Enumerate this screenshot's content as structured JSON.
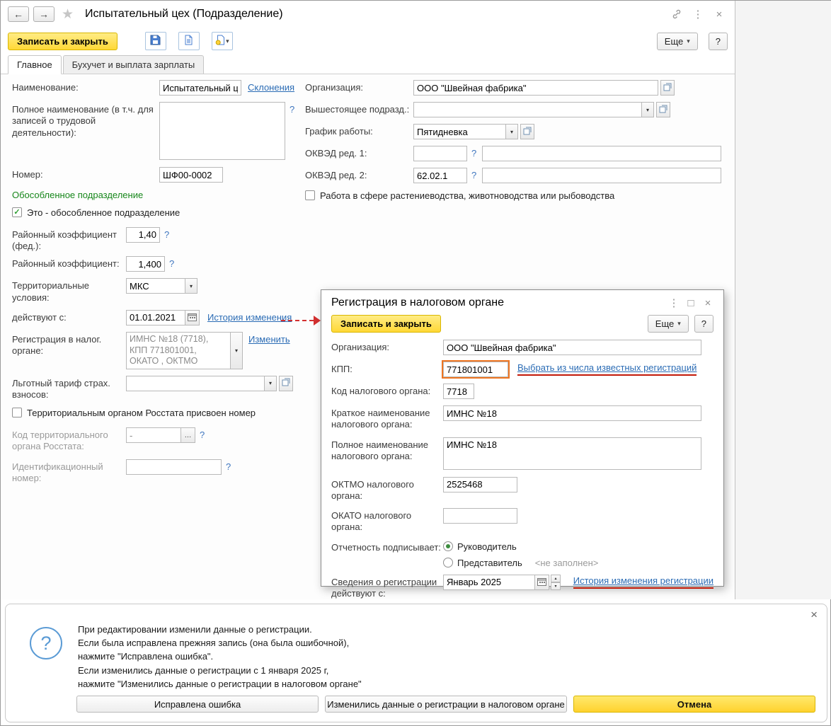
{
  "icons": {
    "back": "←",
    "forward": "→",
    "star": "★",
    "dots": "⋮",
    "close": "×",
    "maximize": "□",
    "caret": "▾",
    "check": "✓",
    "up": "▴",
    "down": "▾",
    "ellipsis": "…",
    "question_hint": "?",
    "question_big": "?"
  },
  "colors": {
    "accent_yellow": "#ffd836",
    "link_blue": "#2b6cb5",
    "annotation_red": "#d43030",
    "highlight_orange": "#ef7622",
    "section_green": "#17871b"
  },
  "window": {
    "title": "Испытательный цех (Подразделение)"
  },
  "toolbar": {
    "save_close": "Записать и закрыть",
    "more": "Еще",
    "help": "?"
  },
  "tabs": [
    {
      "label": "Главное"
    },
    {
      "label": "Бухучет и выплата зарплаты"
    }
  ],
  "form": {
    "name": {
      "label": "Наименование:",
      "value": "Испытательный це",
      "link": "Склонения"
    },
    "full_name": {
      "label": "Полное наименование (в т.ч. для записей о трудовой деятельности):",
      "value": ""
    },
    "number": {
      "label": "Номер:",
      "value": "ШФ00-0002"
    },
    "separate": {
      "heading": "Обособленное подразделение",
      "checkbox": "Это - обособленное подразделение"
    },
    "district_coef_fed": {
      "label": "Районный коэффициент (фед.):",
      "value": "1,40"
    },
    "district_coef": {
      "label": "Районный коэффициент:",
      "value": "1,400"
    },
    "territorial": {
      "label": "Территориальные условия:",
      "value": "МКС"
    },
    "valid_from": {
      "label": "действуют с:",
      "value": "01.01.2021",
      "link": "История изменения"
    },
    "tax_registration": {
      "label": "Регистрация в налог. органе:",
      "value": "ИМНС №18 (7718),\nКПП 771801001,\nОКАТО , ОКТМО",
      "link": "Изменить"
    },
    "privileged_tariff": {
      "label": "Льготный тариф страх. взносов:",
      "value": ""
    },
    "rosstat_checkbox": "Территориальным органом Росстата присвоен номер",
    "rosstat_code": {
      "label": "Код территориального органа Росстата:",
      "value": "-"
    },
    "id_number": {
      "label": "Идентификационный номер:",
      "value": ""
    },
    "organization": {
      "label": "Организация:",
      "value": "ООО \"Швейная фабрика\""
    },
    "parent_dept": {
      "label": "Вышестоящее подразд.:",
      "value": ""
    },
    "schedule": {
      "label": "График работы:",
      "value": "Пятидневка"
    },
    "okved1": {
      "label": "ОКВЭД ред. 1:",
      "code": "",
      "name": ""
    },
    "okved2": {
      "label": "ОКВЭД ред. 2:",
      "code": "62.02.1",
      "name": ""
    },
    "agro_checkbox": "Работа в сфере растениеводства, животноводства или рыбоводства"
  },
  "dialog": {
    "title": "Регистрация в налоговом органе",
    "save_close": "Записать и закрыть",
    "more": "Еще",
    "help": "?",
    "organization": {
      "label": "Организация:",
      "value": "ООО \"Швейная фабрика\""
    },
    "kpp": {
      "label": "КПП:",
      "value": "771801001",
      "link": "Выбрать из числа известных регистраций"
    },
    "tax_code": {
      "label": "Код налогового органа:",
      "value": "7718"
    },
    "short_name": {
      "label": "Краткое наименование налогового органа:",
      "value": "ИМНС №18"
    },
    "full_name": {
      "label": "Полное наименование налогового органа:",
      "value": "ИМНС №18"
    },
    "oktmo": {
      "label": "ОКТМО налогового органа:",
      "value": "2525468"
    },
    "okato": {
      "label": "ОКАТО налогового органа:",
      "value": ""
    },
    "signer": {
      "label": "Отчетность подписывает:",
      "option_head": "Руководитель",
      "option_rep": "Представитель",
      "empty_hint": "<не заполнен>"
    },
    "reg_from": {
      "label": "Сведения о регистрации действуют с:",
      "value": "Январь 2025",
      "link": "История изменения регистрации"
    }
  },
  "notification": {
    "text": "При редактировании изменили данные о регистрации.\nЕсли была исправлена прежняя запись (она была ошибочной),\nнажмите \"Исправлена ошибка\".\nЕсли изменились данные о регистрации с 1 января 2025 г,\nнажмите \"Изменились данные о регистрации в налоговом органе\"",
    "buttons": {
      "fixed": "Исправлена ошибка",
      "changed": "Изменились данные о регистрации в налоговом органе",
      "cancel": "Отмена"
    }
  }
}
